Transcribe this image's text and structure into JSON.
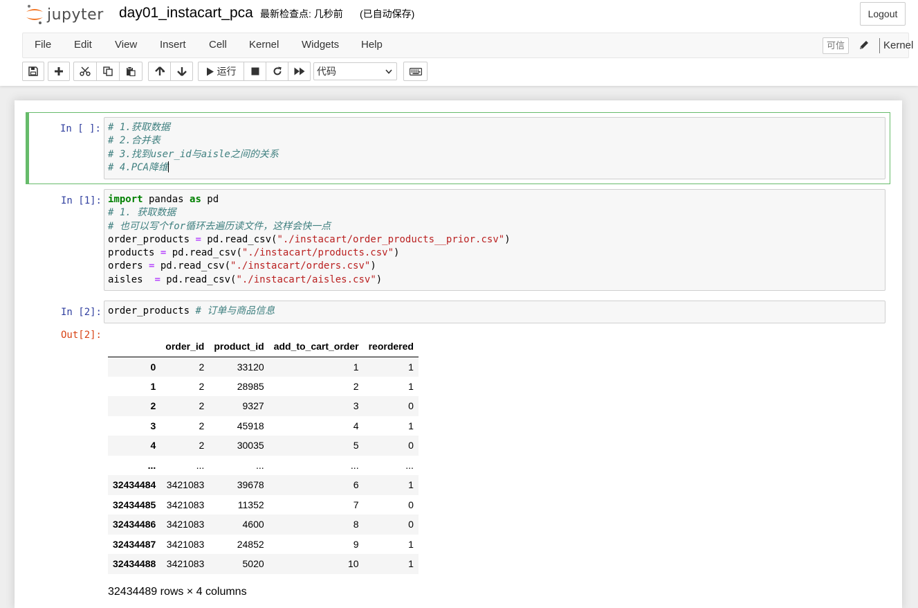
{
  "header": {
    "logo_text": "jupyter",
    "notebook_title": "day01_instacart_pca",
    "checkpoint": "最新检查点: 几秒前",
    "autosave": "(已自动保存)",
    "logout_label": "Logout"
  },
  "menu": {
    "items": [
      "File",
      "Edit",
      "View",
      "Insert",
      "Cell",
      "Kernel",
      "Widgets",
      "Help"
    ],
    "trusted_label": "可信",
    "kernel_label": "Kernel"
  },
  "toolbar": {
    "run_label": "运行",
    "cell_type": "代码"
  },
  "cells": [
    {
      "prompt": "In [ ]:",
      "lines": [
        "# 1.获取数据",
        "# 2.合并表",
        "# 3.找到user_id与aisle之间的关系",
        "# 4.PCA降维"
      ]
    },
    {
      "prompt": "In [1]:",
      "lines": [
        "import pandas as pd",
        "# 1. 获取数据",
        "# 也可以写个for循环去遍历读文件，这样会快一点",
        "order_products = pd.read_csv(\"./instacart/order_products__prior.csv\")",
        "products = pd.read_csv(\"./instacart/products.csv\")",
        "orders = pd.read_csv(\"./instacart/orders.csv\")",
        "aisles  = pd.read_csv(\"./instacart/aisles.csv\")"
      ]
    },
    {
      "prompt": "In [2]:",
      "lines": [
        "order_products # 订单与商品信息"
      ],
      "output_prompt": "Out[2]:"
    }
  ],
  "dataframe": {
    "columns": [
      "order_id",
      "product_id",
      "add_to_cart_order",
      "reordered"
    ],
    "rows": [
      [
        "0",
        "2",
        "33120",
        "1",
        "1"
      ],
      [
        "1",
        "2",
        "28985",
        "2",
        "1"
      ],
      [
        "2",
        "2",
        "9327",
        "3",
        "0"
      ],
      [
        "3",
        "2",
        "45918",
        "4",
        "1"
      ],
      [
        "4",
        "2",
        "30035",
        "5",
        "0"
      ],
      [
        "...",
        "...",
        "...",
        "...",
        "..."
      ],
      [
        "32434484",
        "3421083",
        "39678",
        "6",
        "1"
      ],
      [
        "32434485",
        "3421083",
        "11352",
        "7",
        "0"
      ],
      [
        "32434486",
        "3421083",
        "4600",
        "8",
        "0"
      ],
      [
        "32434487",
        "3421083",
        "24852",
        "9",
        "1"
      ],
      [
        "32434488",
        "3421083",
        "5020",
        "10",
        "1"
      ]
    ],
    "shape": "32434489 rows × 4 columns"
  },
  "colors": {
    "selected_border": "#66bb6a",
    "prompt_in": "#303f9f",
    "prompt_out": "#d84315",
    "comment": "#408080",
    "keyword": "#008000",
    "string": "#ba2121"
  }
}
